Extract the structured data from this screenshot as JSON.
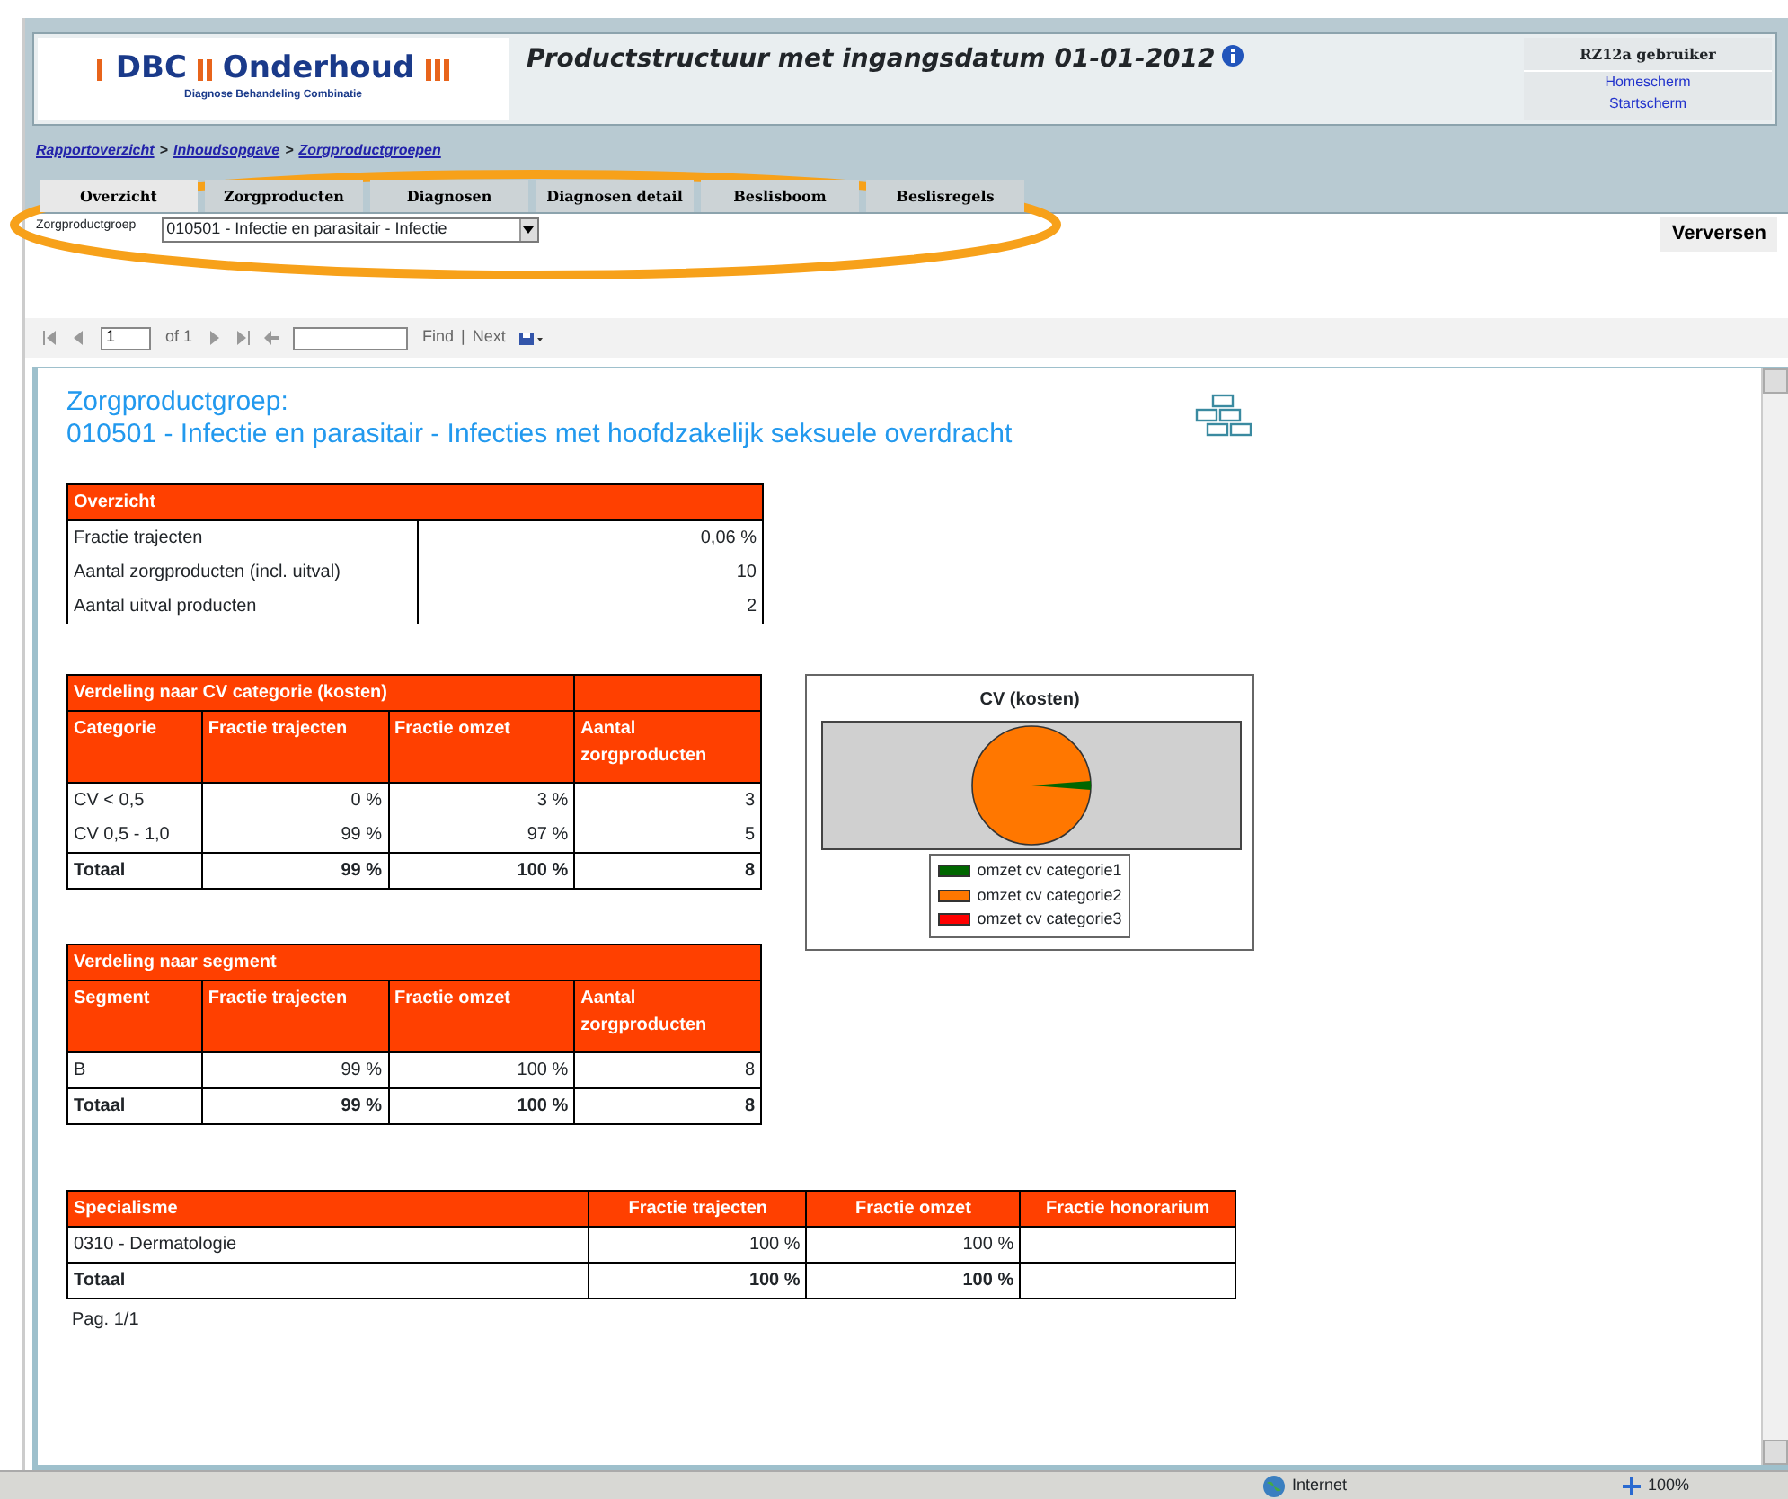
{
  "header": {
    "logo": {
      "brand": "DBC",
      "product": "Onderhoud",
      "tagline": "Diagnose Behandeling Combinatie"
    },
    "title": "Productstructuur met ingangsdatum 01-01-2012",
    "user": "RZ12a gebruiker",
    "links": [
      "Homescherm",
      "Startscherm"
    ]
  },
  "breadcrumb": {
    "separator": ">",
    "items": [
      "Rapportoverzicht",
      "Inhoudsopgave",
      "Zorgproductgroepen"
    ]
  },
  "tabs": [
    {
      "label": "Overzicht",
      "selected": true
    },
    {
      "label": "Zorgproducten",
      "selected": false
    },
    {
      "label": "Diagnosen",
      "selected": false
    },
    {
      "label": "Diagnosen detail",
      "selected": false
    },
    {
      "label": "Beslisboom",
      "selected": false
    },
    {
      "label": "Beslisregels",
      "selected": false
    }
  ],
  "annotation_ellipse": true,
  "parameters": {
    "label": "Zorgproductgroep",
    "value": "010501 - Infectie en parasitair - Infectie",
    "button": "Verversen"
  },
  "toolbar": {
    "page": "1",
    "of": "of 1",
    "find": "Find",
    "separator": "|",
    "next": "Next"
  },
  "report": {
    "heading": "Zorgproductgroep:",
    "subheading": "010501 - Infectie en parasitair - Infecties met hoofdzakelijk seksuele overdracht",
    "overview": {
      "title": "Overzicht",
      "rows": [
        [
          "Fractie trajecten",
          "0,06 %"
        ],
        [
          "Aantal zorgproducten (incl. uitval)",
          "10"
        ],
        [
          "Aantal uitval producten",
          "2"
        ]
      ]
    },
    "cv_table": {
      "title": "Verdeling naar CV categorie (kosten)",
      "columns": [
        "Categorie",
        "Fractie trajecten",
        "Fractie omzet",
        "Aantal zorgproducten"
      ],
      "rows": [
        [
          "CV < 0,5",
          "0 %",
          "3 %",
          "3"
        ],
        [
          "CV 0,5 - 1,0",
          "99 %",
          "97 %",
          "5"
        ]
      ],
      "total": [
        "Totaal",
        "99 %",
        "100 %",
        "8"
      ]
    },
    "segment_table": {
      "title": "Verdeling naar segment",
      "columns": [
        "Segment",
        "Fractie trajecten",
        "Fractie omzet",
        "Aantal zorgproducten"
      ],
      "rows": [
        [
          "B",
          "99 %",
          "100 %",
          "8"
        ]
      ],
      "total": [
        "Totaal",
        "99 %",
        "100 %",
        "8"
      ]
    },
    "chart": {
      "title": "CV (kosten)",
      "legend": [
        {
          "label": "omzet cv categorie1",
          "color": "#006600"
        },
        {
          "label": "omzet cv categorie2",
          "color": "#ff7700"
        },
        {
          "label": "omzet cv categorie3",
          "color": "#ff0000"
        }
      ]
    },
    "specialism_table": {
      "columns": [
        "Specialisme",
        "Fractie trajecten",
        "Fractie omzet",
        "Fractie honorarium"
      ],
      "rows": [
        [
          "0310 - Dermatologie",
          "100 %",
          "100 %"
        ]
      ],
      "total": [
        "Totaal",
        "100 %",
        "100 %"
      ]
    },
    "page_label": "Pag. 1/1"
  },
  "status_bar": {
    "zone": "Internet",
    "zoom": "100%"
  }
}
